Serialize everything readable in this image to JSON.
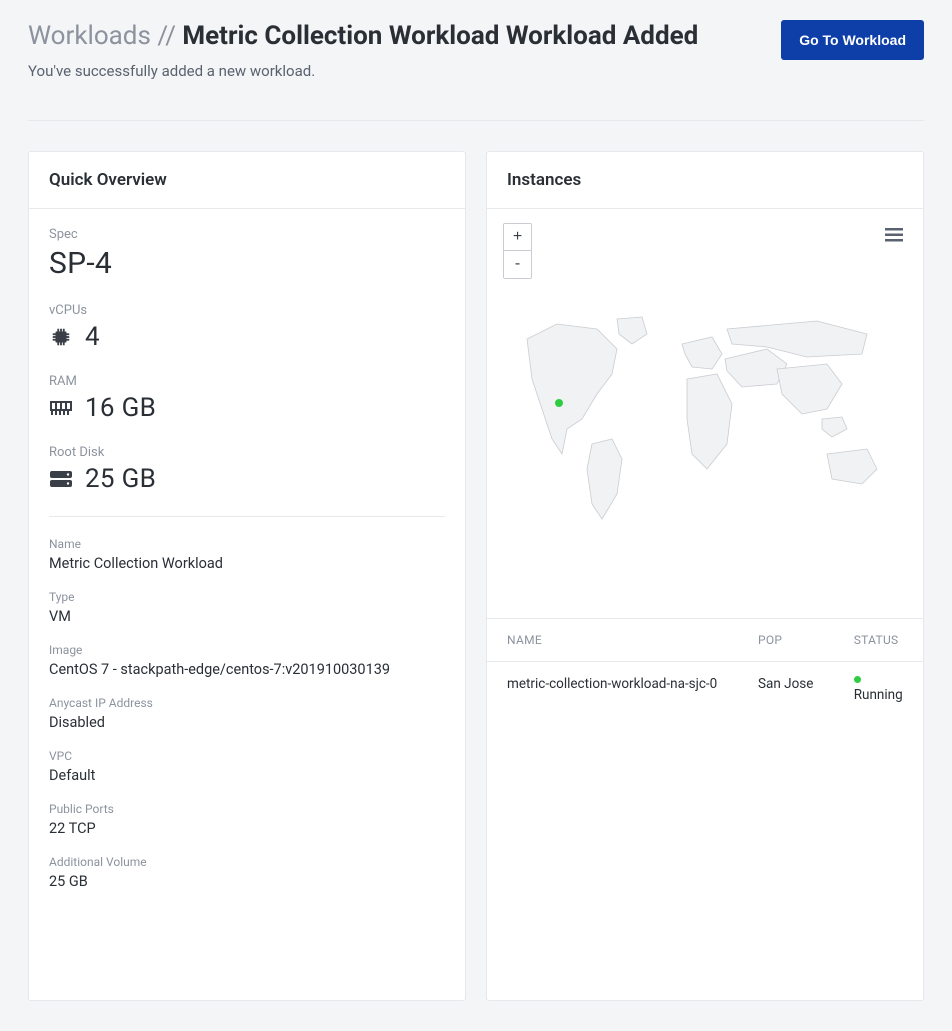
{
  "header": {
    "breadcrumb_prefix": "Workloads // ",
    "title": "Metric Collection Workload Workload Added",
    "subtitle": "You've successfully added a new workload.",
    "cta_label": "Go To Workload"
  },
  "overview": {
    "card_title": "Quick Overview",
    "spec_label": "Spec",
    "spec_value": "SP-4",
    "vcpus_label": "vCPUs",
    "vcpus_value": "4",
    "ram_label": "RAM",
    "ram_value": "16 GB",
    "rootdisk_label": "Root Disk",
    "rootdisk_value": "25 GB",
    "details": {
      "name_label": "Name",
      "name_value": "Metric Collection Workload",
      "type_label": "Type",
      "type_value": "VM",
      "image_label": "Image",
      "image_value": "CentOS 7 - stackpath-edge/centos-7:v201910030139",
      "anycast_label": "Anycast IP Address",
      "anycast_value": "Disabled",
      "vpc_label": "VPC",
      "vpc_value": "Default",
      "ports_label": "Public Ports",
      "ports_value": "22 TCP",
      "volume_label": "Additional Volume",
      "volume_value": "25 GB"
    }
  },
  "instances": {
    "card_title": "Instances",
    "zoom_in": "+",
    "zoom_out": "-",
    "columns": {
      "name": "NAME",
      "pop": "POP",
      "status": "STATUS"
    },
    "rows": [
      {
        "name": "metric-collection-workload-na-sjc-0",
        "pop": "San Jose",
        "status": "Running"
      }
    ]
  }
}
